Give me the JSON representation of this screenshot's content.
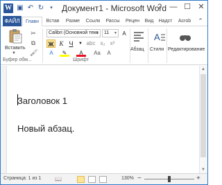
{
  "window": {
    "title": "Документ1 - Microsoft Word",
    "app_icon_letter": "W",
    "controls": [
      "?",
      "—",
      "☐",
      "✕"
    ]
  },
  "tabs": {
    "file": "ФАЙЛ",
    "items": [
      "Главн",
      "Встав",
      "Разме",
      "Ссылк",
      "Рассы",
      "Рецен",
      "Вид",
      "Надст",
      "Acrob"
    ]
  },
  "ribbon": {
    "clipboard": {
      "paste_label": "Вставить",
      "group_label": "Буфер обм..."
    },
    "font": {
      "family": "Calibri (Основной текс",
      "size": "11",
      "bold": "Ж",
      "italic": "К",
      "underline": "Ч",
      "group_label": "Шрифт"
    },
    "paragraph": {
      "label": "Абзац"
    },
    "styles": {
      "label": "Стили"
    },
    "editing": {
      "label": "Редактирование"
    }
  },
  "document": {
    "heading": "Заголовок 1",
    "paragraph": "Новый абзац."
  },
  "status": {
    "page": "Страница: 1 из 1",
    "zoom": "130%",
    "zoom_minus": "−",
    "zoom_plus": "+"
  },
  "colors": {
    "accent": "#2b579a",
    "highlight": "#ffff00",
    "font_color": "#e81123"
  }
}
